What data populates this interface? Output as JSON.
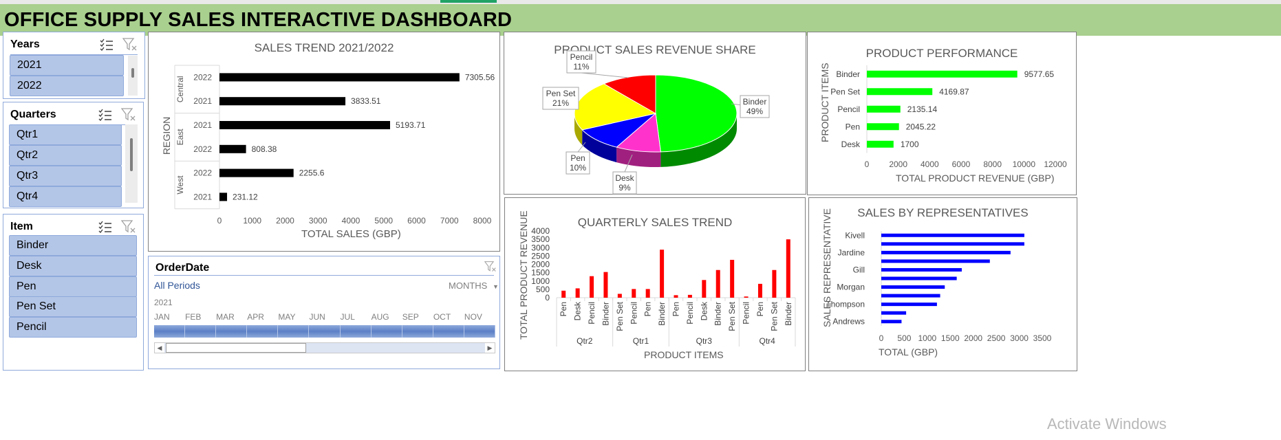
{
  "dashboard": {
    "title": "OFFICE SUPPLY SALES INTERACTIVE DASHBOARD",
    "header_color": "#a9d08e"
  },
  "slicers": {
    "years": {
      "title": "Years",
      "items": [
        "2021",
        "2022"
      ]
    },
    "quarters": {
      "title": "Quarters",
      "items": [
        "Qtr1",
        "Qtr2",
        "Qtr3",
        "Qtr4"
      ]
    },
    "item": {
      "title": "Item",
      "items": [
        "Binder",
        "Desk",
        "Pen",
        "Pen Set",
        "Pencil"
      ]
    },
    "button_color": "#b4c6e7"
  },
  "timeline": {
    "title": "OrderDate",
    "period_label": "All Periods",
    "granularity": "MONTHS",
    "year": "2021",
    "months": [
      "JAN",
      "FEB",
      "MAR",
      "APR",
      "MAY",
      "JUN",
      "JUL",
      "AUG",
      "SEP",
      "OCT",
      "NOV"
    ]
  },
  "watermark": "Activate Windows",
  "chart_data": [
    {
      "id": "sales_trend",
      "type": "bar",
      "orientation": "horizontal",
      "title": "SALES TREND 2021/2022",
      "xlabel": "TOTAL SALES (GBP)",
      "ylabel": "REGION",
      "xlim": [
        0,
        8000
      ],
      "xticks": [
        0,
        1000,
        2000,
        3000,
        4000,
        5000,
        6000,
        7000,
        8000
      ],
      "groups": [
        {
          "name": "Central",
          "rows": [
            {
              "label": "2022",
              "value": 7305.56
            },
            {
              "label": "2021",
              "value": 3833.51
            }
          ]
        },
        {
          "name": "East",
          "rows": [
            {
              "label": "2021",
              "value": 5193.71
            },
            {
              "label": "2022",
              "value": 808.38
            }
          ]
        },
        {
          "name": "West",
          "rows": [
            {
              "label": "2022",
              "value": 2255.6
            },
            {
              "label": "2021",
              "value": 231.12
            }
          ]
        }
      ],
      "color": "#000000",
      "data_labels": [
        "7305.56",
        "3833.51",
        "5193.71",
        "808.38",
        "2255.6",
        "231.12"
      ]
    },
    {
      "id": "revenue_share",
      "type": "pie",
      "title": "PRODUCT SALES REVENUE SHARE",
      "slices": [
        {
          "label": "Binder",
          "percent": 49,
          "text": "49%",
          "color": "#00ff00",
          "dark": "#008a00"
        },
        {
          "label": "Desk",
          "percent": 9,
          "text": "9%",
          "color": "#ff33cc",
          "dark": "#a0207f"
        },
        {
          "label": "Pen",
          "percent": 10,
          "text": "10%",
          "color": "#0000ff",
          "dark": "#00009a"
        },
        {
          "label": "Pen Set",
          "percent": 21,
          "text": "21%",
          "color": "#ffff00",
          "dark": "#a8a800"
        },
        {
          "label": "Pencil",
          "percent": 11,
          "text": "11%",
          "color": "#ff0000",
          "dark": "#a00000"
        }
      ]
    },
    {
      "id": "product_performance",
      "type": "bar",
      "orientation": "horizontal",
      "title": "PRODUCT PERFORMANCE",
      "xlabel": "TOTAL PRODUCT REVENUE (GBP)",
      "ylabel": "PRODUCT ITEMS",
      "xlim": [
        0,
        12000
      ],
      "xticks": [
        0,
        2000,
        4000,
        6000,
        8000,
        10000,
        12000
      ],
      "categories": [
        "Binder",
        "Pen Set",
        "Pencil",
        "Pen",
        "Desk"
      ],
      "values": [
        9577.65,
        4169.87,
        2135.14,
        2045.22,
        1700
      ],
      "data_labels": [
        "9577.65",
        "4169.87",
        "2135.14",
        "2045.22",
        "1700"
      ],
      "color": "#00ff00"
    },
    {
      "id": "quarterly_trend",
      "type": "bar",
      "title": "QUARTERLY SALES TREND",
      "xlabel": "PRODUCT ITEMS",
      "ylabel": "TOTAL PRODUCT REVENUE",
      "ylim": [
        0,
        4000
      ],
      "yticks": [
        0,
        500,
        1000,
        1500,
        2000,
        2500,
        3000,
        3500,
        4000
      ],
      "groups": [
        {
          "name": "Qtr2",
          "items": [
            {
              "label": "Pen",
              "value": 420
            },
            {
              "label": "Desk",
              "value": 560
            },
            {
              "label": "Pencil",
              "value": 1290
            },
            {
              "label": "Binder",
              "value": 1540
            }
          ]
        },
        {
          "name": "Qtr1",
          "items": [
            {
              "label": "Pen Set",
              "value": 230
            },
            {
              "label": "Pencil",
              "value": 520
            },
            {
              "label": "Pen",
              "value": 520
            },
            {
              "label": "Binder",
              "value": 2880
            }
          ]
        },
        {
          "name": "Qtr3",
          "items": [
            {
              "label": "Pen",
              "value": 150
            },
            {
              "label": "Pencil",
              "value": 170
            },
            {
              "label": "Desk",
              "value": 1060
            },
            {
              "label": "Binder",
              "value": 1660
            },
            {
              "label": "Pen Set",
              "value": 2270
            }
          ]
        },
        {
          "name": "Qtr4",
          "items": [
            {
              "label": "Pencil",
              "value": 70
            },
            {
              "label": "Pen",
              "value": 830
            },
            {
              "label": "Pen Set",
              "value": 1660
            },
            {
              "label": "Binder",
              "value": 3500
            }
          ]
        }
      ],
      "color": "#ff0000"
    },
    {
      "id": "sales_by_rep",
      "type": "bar",
      "orientation": "horizontal",
      "title": "SALES BY REPRESENTATIVES",
      "xlabel": "TOTAL (GBP)",
      "ylabel": "SALES REPRESENTATIVE",
      "xlim": [
        0,
        3500
      ],
      "xticks": [
        0,
        500,
        1000,
        1500,
        2000,
        2500,
        3000,
        3500
      ],
      "category_labels": [
        "Kivell",
        "Jardine",
        "Gill",
        "Morgan",
        "Thompson",
        "Andrews"
      ],
      "values": [
        3110,
        3110,
        2810,
        2360,
        1750,
        1640,
        1380,
        1280,
        1210,
        540,
        440
      ],
      "color": "#0000ff"
    }
  ]
}
